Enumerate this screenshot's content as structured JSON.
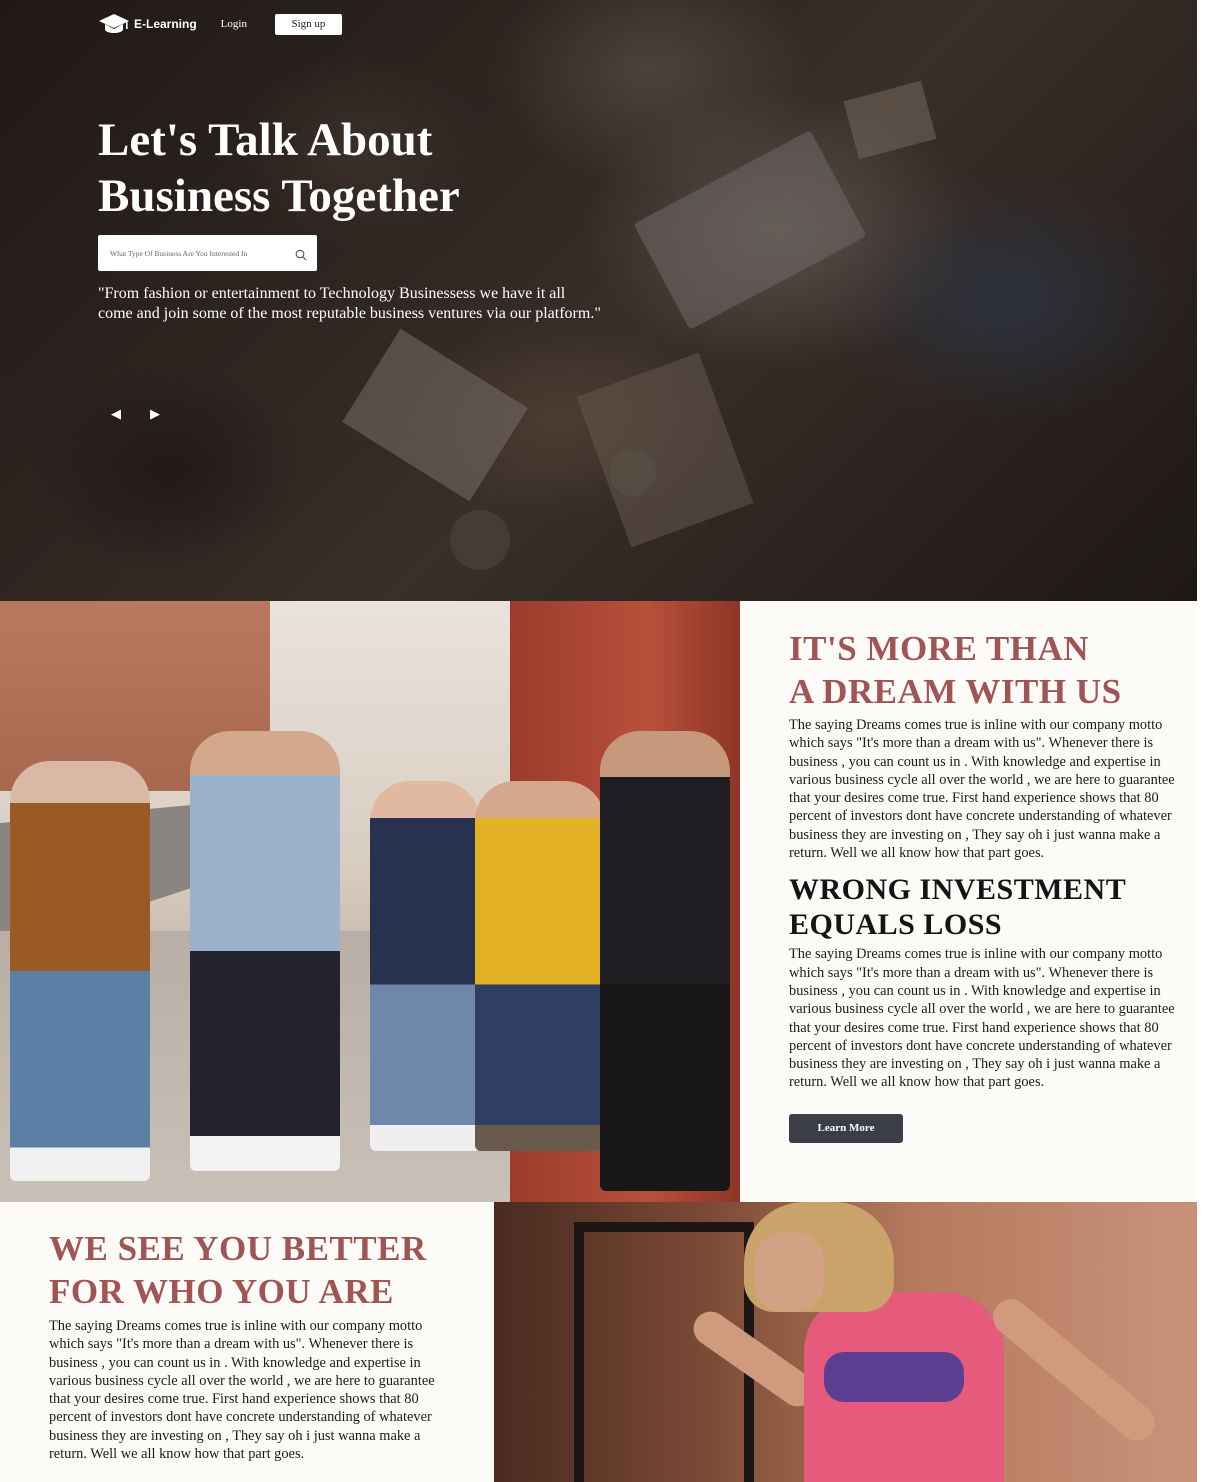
{
  "nav": {
    "logo_text": "E-Learning",
    "login_label": "Login",
    "signup_label": "Sign up"
  },
  "hero": {
    "title_line1": "Let's Talk About",
    "title_line2": "Business Together",
    "search_placeholder": "What Type Of Business Are You Interested In",
    "quote_line1": "\"From fashion or entertainment to Technology Businessess we have it all",
    "quote_line2": "come and join some of the most reputable business ventures via our platform.\"",
    "prev_arrow": "◀",
    "next_arrow": "▶"
  },
  "dream_section": {
    "heading_line1": "IT'S MORE THAN",
    "heading_line2": "A DREAM WITH US",
    "body": "The saying Dreams comes true is inline with our company motto which says \"It's more than a dream with us\". Whenever there is business , you can count us in . With knowledge and expertise in various business cycle all over the world , we are here to guarantee that your desires come true. First hand experience shows that 80 percent of investors dont have concrete understanding of whatever business they are investing on , They say oh i just wanna make a return. Well we all know how that part goes.",
    "subheading_line1": "WRONG INVESTMENT",
    "subheading_line2": "EQUALS LOSS",
    "body2": "The saying Dreams comes true is inline with our company motto which says \"It's more than a dream with us\". Whenever there is business , you can count us in . With knowledge and expertise in various business cycle all over the world , we are here to guarantee that your desires come true. First hand experience shows that 80 percent of investors dont have concrete understanding of whatever business they are investing on , They say oh i just wanna make a return. Well we all know how that part goes.",
    "button_label": "Learn More"
  },
  "better_section": {
    "heading_line1": "WE SEE YOU BETTER",
    "heading_line2": "FOR WHO YOU ARE",
    "body": "The saying Dreams comes true is inline with our company motto which says \"It's more than a dream with us\". Whenever there is business , you can count us in . With knowledge and expertise in various business cycle all over the world , we are here to guarantee that your desires come true. First hand experience shows that 80 percent of investors dont have concrete understanding of whatever business they are investing on , They say oh i just wanna make a return. Well we all know how that part goes."
  },
  "colors": {
    "accent_maroon": "#a05454",
    "button_dark": "#3b3e48",
    "panel_background": "#fdfbf7"
  },
  "icons": {
    "logo": "graduation-cap-icon",
    "search": "search-icon"
  }
}
